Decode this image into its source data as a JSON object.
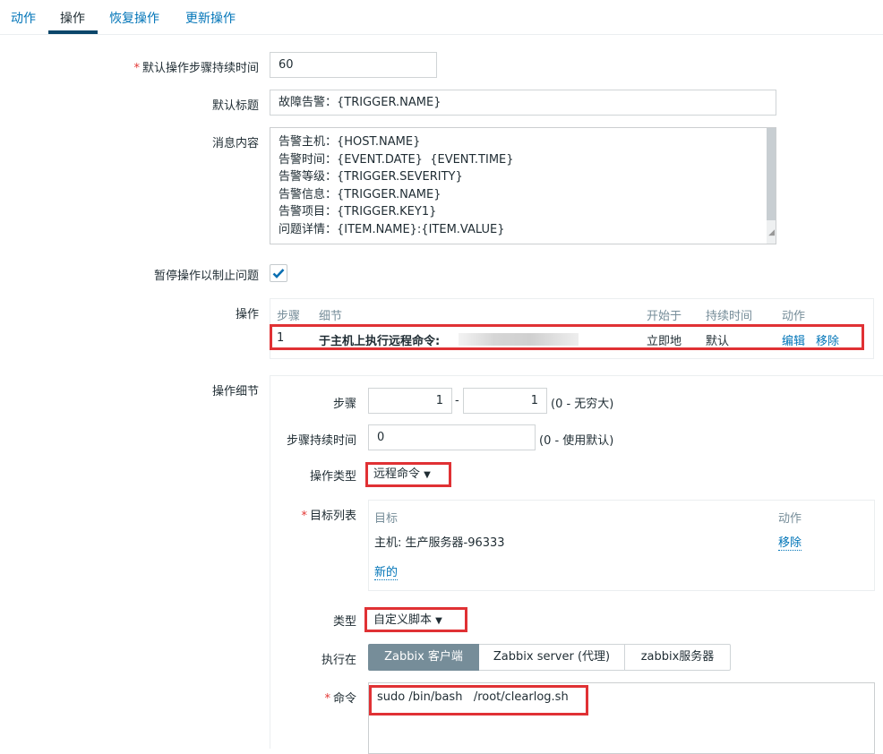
{
  "tabs": [
    {
      "label": "动作",
      "active": false
    },
    {
      "label": "操作",
      "active": true
    },
    {
      "label": "恢复操作",
      "active": false
    },
    {
      "label": "更新操作",
      "active": false
    }
  ],
  "form": {
    "default_step_duration": {
      "label": "默认操作步骤持续时间",
      "required": true,
      "value": "60"
    },
    "default_subject": {
      "label": "默认标题",
      "value": "故障告警：{TRIGGER.NAME}"
    },
    "message": {
      "label": "消息内容",
      "lines": [
        "告警主机：{HOST.NAME}",
        "告警时间：{EVENT.DATE}  {EVENT.TIME}",
        "告警等级：{TRIGGER.SEVERITY}",
        "告警信息：{TRIGGER.NAME}",
        "告警项目：{TRIGGER.KEY1}",
        "问题详情：{ITEM.NAME}:{ITEM.VALUE}"
      ]
    },
    "pause_suppressed": {
      "label": "暂停操作以制止问题",
      "checked": true
    },
    "operations": {
      "label": "操作",
      "headers": {
        "step": "步骤",
        "details": "细节",
        "start_in": "开始于",
        "duration": "持续时间",
        "action": "动作"
      },
      "rows": [
        {
          "step": "1",
          "details": "于主机上执行远程命令:",
          "start_in": "立即地",
          "duration": "默认",
          "edit": "编辑",
          "remove": "移除"
        }
      ]
    }
  },
  "operation_details": {
    "label": "操作细节",
    "steps": {
      "label": "步骤",
      "from": "1",
      "separator": "-",
      "to": "1",
      "hint": "(0 - 无穷大)"
    },
    "step_duration": {
      "label": "步骤持续时间",
      "value": "0",
      "hint": "(0 - 使用默认)"
    },
    "operation_type": {
      "label": "操作类型",
      "value": "远程命令"
    },
    "target_list": {
      "label": "目标列表",
      "required": true,
      "headers": {
        "target": "目标",
        "action": "动作"
      },
      "rows": [
        {
          "target": "主机: 生产服务器-96333",
          "remove": "移除"
        }
      ],
      "new_link": "新的"
    },
    "type": {
      "label": "类型",
      "value": "自定义脚本"
    },
    "execute_on": {
      "label": "执行在",
      "options": [
        "Zabbix 客户端",
        "Zabbix server (代理)",
        "zabbix服务器"
      ],
      "selected": 0
    },
    "command": {
      "label": "命令",
      "required": true,
      "value": "sudo /bin/bash   /root/clearlog.sh"
    }
  },
  "colors": {
    "link": "#0275b8",
    "highlight_box": "#e03134",
    "segment_selected": "#768d99"
  }
}
